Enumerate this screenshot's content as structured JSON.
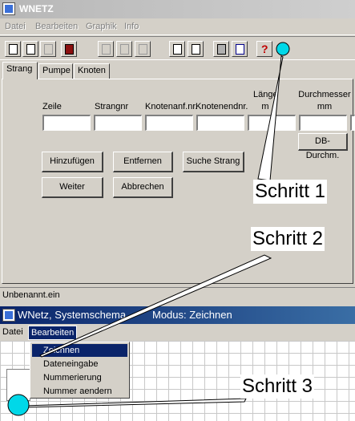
{
  "main_window": {
    "title": "WNETZ",
    "menu": [
      "Datei",
      "Bearbeiten",
      "Graphik",
      "Info"
    ],
    "toolbar_icons": [
      "new-file-icon",
      "open-file-icon",
      "copy-icon",
      "device-icon",
      "cut-icon",
      "paste-icon",
      "delete-icon",
      "import-icon",
      "edit-icon",
      "calculator-icon",
      "chart-icon",
      "help-icon"
    ],
    "tabs": [
      "Strang",
      "Pumpe",
      "Knoten"
    ],
    "form": {
      "headers": [
        "Zeile",
        "Strangnr",
        "Knotenanf.nr.",
        "Knotenendnr.",
        "Länge\nm",
        "Durchmesser\nmm"
      ],
      "db_button": "DB-Durchm."
    },
    "buttons": {
      "add": "Hinzufügen",
      "remove": "Entfernen",
      "search": "Suche Strang",
      "next": "Weiter",
      "cancel": "Abbrechen"
    },
    "status": "Unbenannt.ein"
  },
  "schema_window": {
    "title": "WNetz, Systemschema",
    "mode": "Modus: Zeichnen",
    "menu": [
      "Datei",
      "Bearbeiten"
    ],
    "dropdown": [
      "Zeichnen",
      "Dateneingabe",
      "Nummerierung",
      "Nummer aendern"
    ],
    "selected_item": "Zeichnen"
  },
  "callouts": {
    "step1": "Schritt 1",
    "step2": "Schritt 2",
    "step3": "Schritt 3"
  },
  "colors": {
    "marker": "#00d8e8",
    "active_title": "#0a246a",
    "face": "#d4d0c8"
  }
}
